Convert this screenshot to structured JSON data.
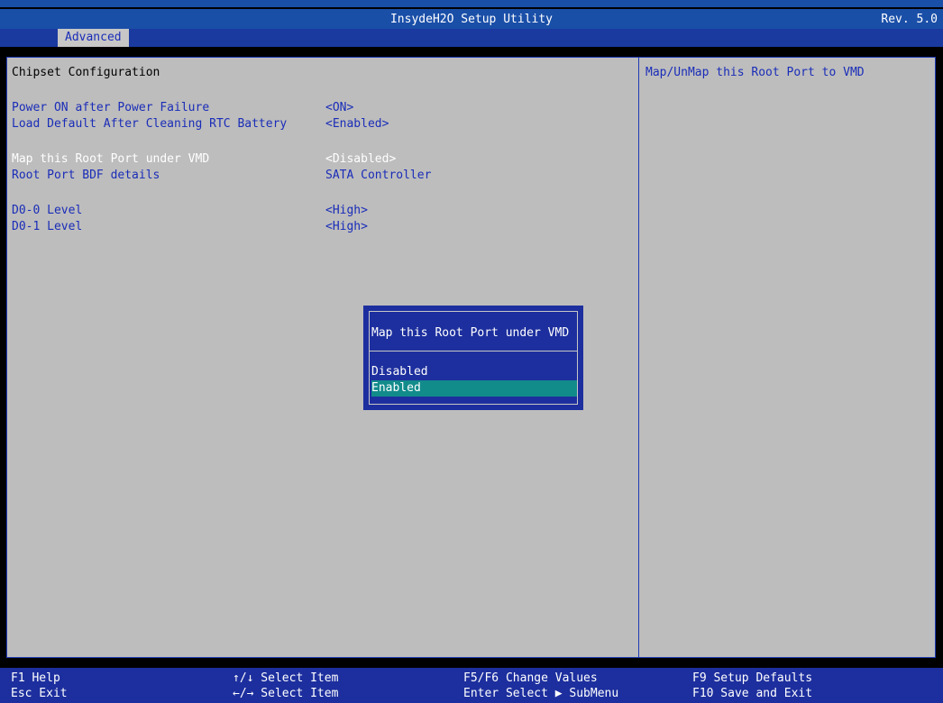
{
  "header": {
    "title": "InsydeH2O Setup Utility",
    "revision": "Rev. 5.0",
    "active_tab": "Advanced"
  },
  "main": {
    "section_title": "Chipset Configuration",
    "items": [
      {
        "label": "Power ON after Power Failure",
        "value": "<ON>"
      },
      {
        "label": "Load Default After Cleaning RTC Battery",
        "value": "<Enabled>"
      },
      {
        "label": "Map this Root Port under VMD",
        "value": "<Disabled>"
      },
      {
        "label": "Root Port BDF details",
        "value": "SATA Controller"
      },
      {
        "label": "D0-0 Level",
        "value": "<High>"
      },
      {
        "label": "D0-1 Level",
        "value": "<High>"
      }
    ]
  },
  "help": {
    "text": "Map/UnMap this Root Port to VMD"
  },
  "popup": {
    "title": "Map this Root Port under VMD",
    "options": [
      "Disabled",
      "Enabled"
    ],
    "selected": "Enabled"
  },
  "footer": {
    "f1": "F1  Help",
    "esc": "Esc Exit",
    "updown": "↑/↓ Select Item",
    "leftright": "←/→ Select Item",
    "f5f6": "F5/F6 Change Values",
    "enter": "Enter Select ▶ SubMenu",
    "f9": "F9  Setup Defaults",
    "f10": "F10 Save and Exit"
  },
  "colors": {
    "header_blue": "#1a4fa8",
    "panel_gray": "#bdbdbd",
    "text_blue": "#1a2db8",
    "highlight_teal": "#128b8b"
  }
}
